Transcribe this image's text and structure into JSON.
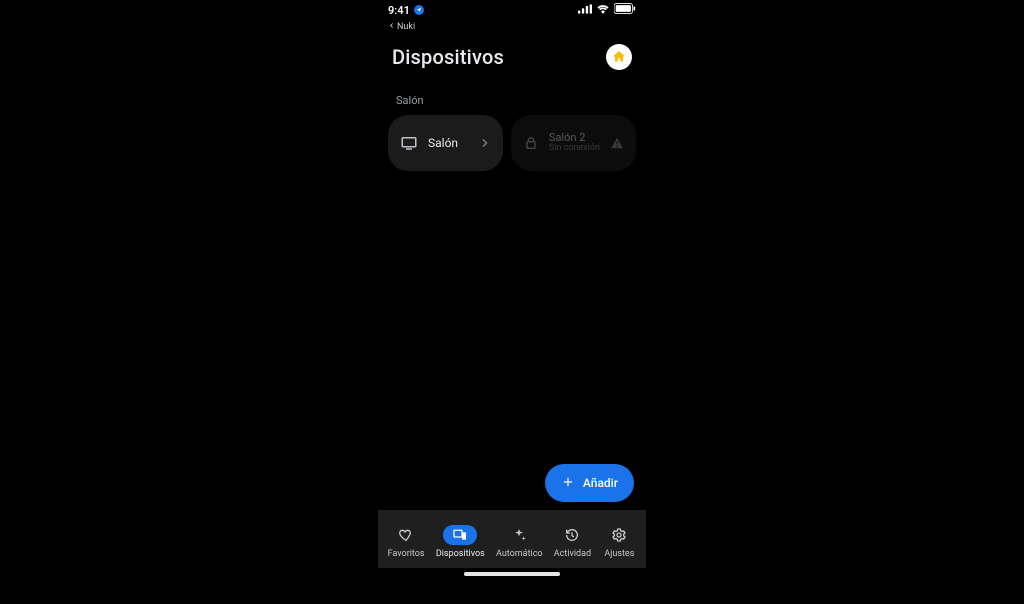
{
  "status": {
    "time": "9:41",
    "back_app": "Nuki"
  },
  "header": {
    "title": "Dispositivos"
  },
  "room": {
    "label": "Salón"
  },
  "devices": [
    {
      "name": "Salón"
    },
    {
      "name": "Salón 2",
      "status": "Sin conexión"
    }
  ],
  "fab": {
    "label": "Añadir"
  },
  "tabs": {
    "favorites": "Favoritos",
    "devices": "Dispositivos",
    "automations": "Automático",
    "activity": "Actividad",
    "settings": "Ajustes"
  }
}
